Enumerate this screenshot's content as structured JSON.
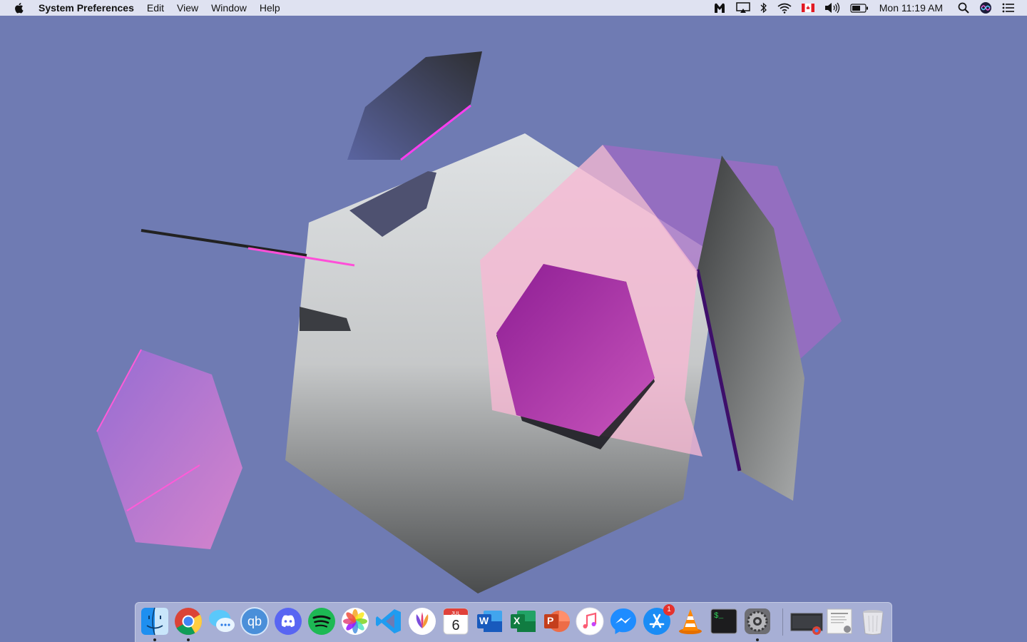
{
  "menubar": {
    "app_name": "System Preferences",
    "menus": [
      "Edit",
      "View",
      "Window",
      "Help"
    ],
    "clock": "Mon 11:19 AM",
    "status_icons": [
      "malwarebytes-icon",
      "airplay-icon",
      "bluetooth-icon",
      "wifi-icon",
      "canada-flag-icon",
      "volume-icon",
      "battery-icon",
      "clock",
      "spotlight-icon",
      "siri-icon",
      "notification-center-icon"
    ]
  },
  "dock": {
    "apps": [
      {
        "name": "Finder",
        "icon": "finder-icon",
        "running": true
      },
      {
        "name": "Google Chrome",
        "icon": "chrome-icon",
        "running": true
      },
      {
        "name": "Messages",
        "icon": "messages-icon",
        "running": false
      },
      {
        "name": "qBittorrent",
        "icon": "qbittorrent-icon",
        "running": false,
        "label": "qb"
      },
      {
        "name": "Discord",
        "icon": "discord-icon",
        "running": false
      },
      {
        "name": "Spotify",
        "icon": "spotify-icon",
        "running": false
      },
      {
        "name": "Photos",
        "icon": "photos-icon",
        "running": false
      },
      {
        "name": "Visual Studio Code",
        "icon": "vscode-icon",
        "running": false
      },
      {
        "name": "Affinity",
        "icon": "affinity-icon",
        "running": false
      },
      {
        "name": "Calendar",
        "icon": "calendar-icon",
        "running": false,
        "month": "JUL",
        "day": "6"
      },
      {
        "name": "Microsoft Word",
        "icon": "word-icon",
        "running": false,
        "label": "W"
      },
      {
        "name": "Microsoft Excel",
        "icon": "excel-icon",
        "running": false,
        "label": "X"
      },
      {
        "name": "Microsoft PowerPoint",
        "icon": "powerpoint-icon",
        "running": false,
        "label": "P"
      },
      {
        "name": "iTunes",
        "icon": "itunes-icon",
        "running": false
      },
      {
        "name": "Messenger",
        "icon": "messenger-icon",
        "running": false
      },
      {
        "name": "App Store",
        "icon": "app-store-icon",
        "running": false,
        "badge": "1"
      },
      {
        "name": "VLC",
        "icon": "vlc-icon",
        "running": false
      },
      {
        "name": "Terminal",
        "icon": "terminal-icon",
        "running": false,
        "label": "$_"
      },
      {
        "name": "System Preferences",
        "icon": "system-preferences-icon",
        "running": true
      }
    ],
    "others": [
      {
        "name": "Chrome window",
        "icon": "chrome-window-thumbnail-icon"
      },
      {
        "name": "Document",
        "icon": "document-stack-icon"
      },
      {
        "name": "Trash",
        "icon": "trash-icon"
      }
    ]
  }
}
